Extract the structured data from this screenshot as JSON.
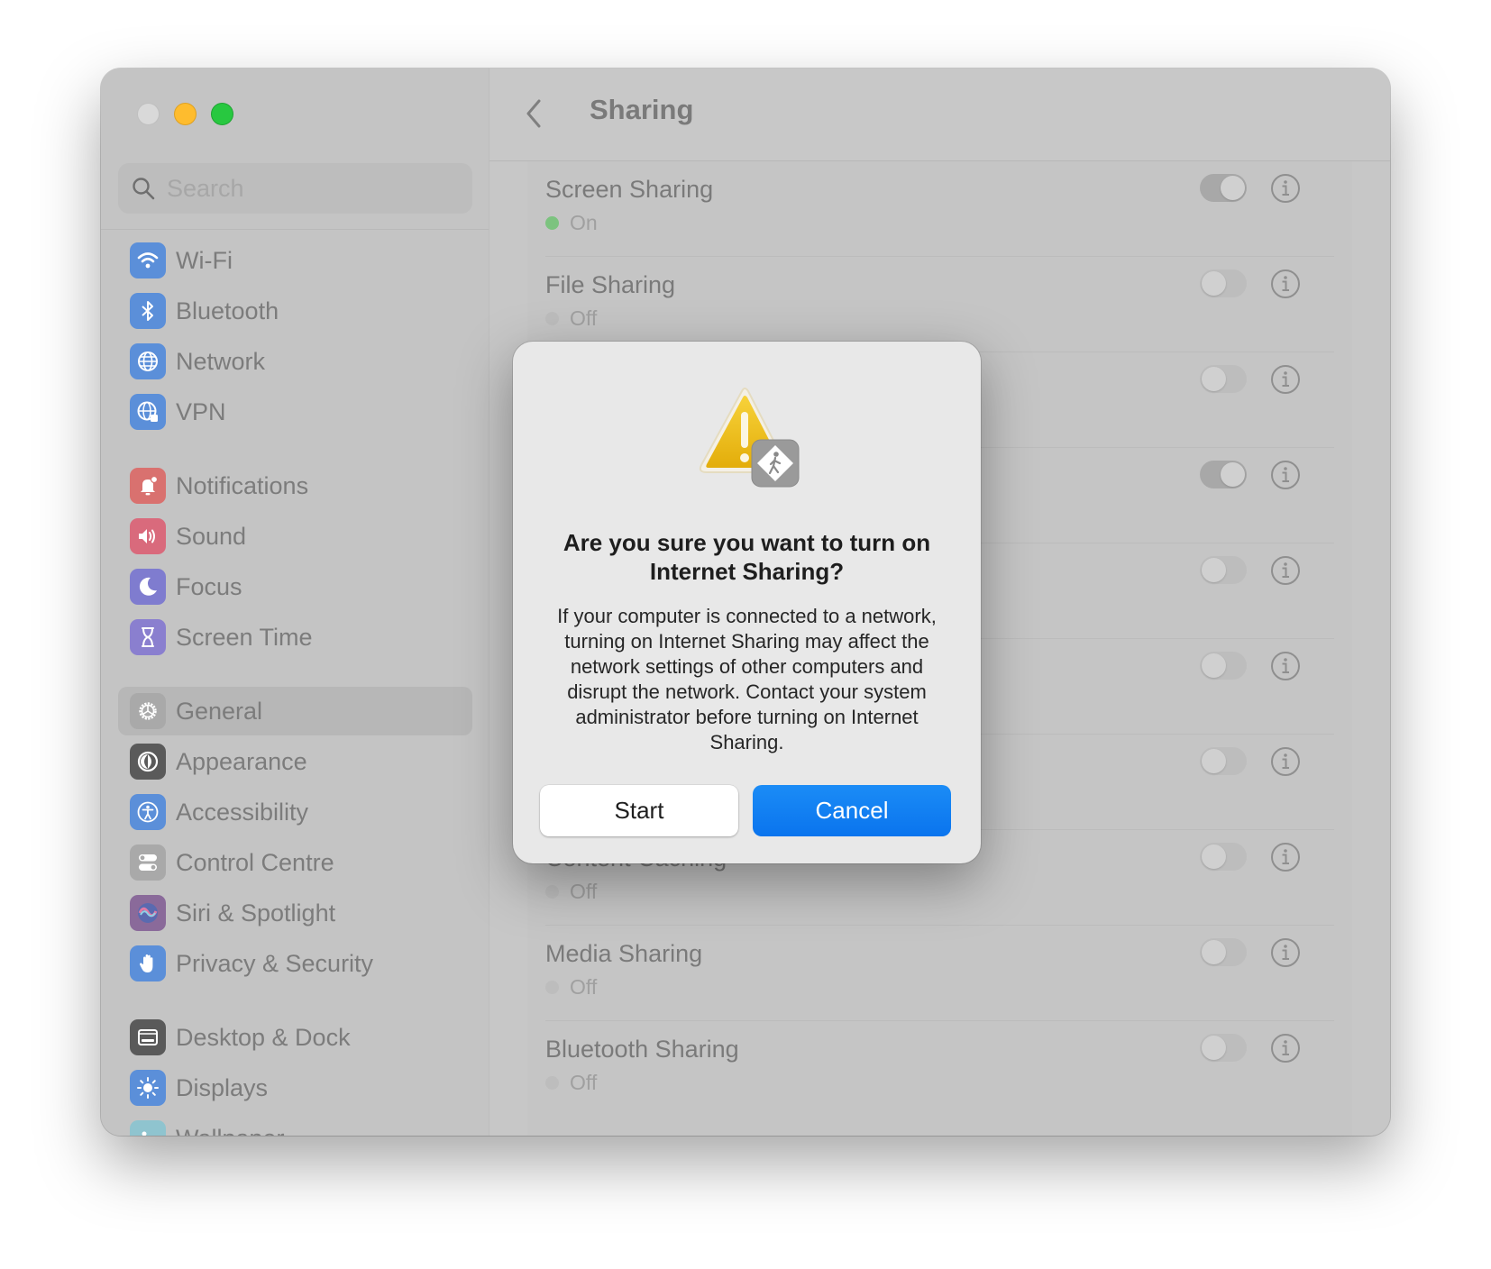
{
  "window": {
    "traffic_lights": [
      "close",
      "minimize",
      "maximize"
    ]
  },
  "sidebar": {
    "search_placeholder": "Search",
    "items": [
      {
        "label": "Wi-Fi",
        "icon": "wifi-icon",
        "color": "#5b8fd9"
      },
      {
        "label": "Bluetooth",
        "icon": "bluetooth-icon",
        "color": "#5b8fd9"
      },
      {
        "label": "Network",
        "icon": "globe-icon",
        "color": "#5b8fd9"
      },
      {
        "label": "VPN",
        "icon": "vpn-globe-icon",
        "color": "#5b8fd9"
      },
      {
        "label": "Notifications",
        "icon": "bell-icon",
        "color": "#d9716f"
      },
      {
        "label": "Sound",
        "icon": "speaker-icon",
        "color": "#d96a7c"
      },
      {
        "label": "Focus",
        "icon": "moon-icon",
        "color": "#7f7ccf"
      },
      {
        "label": "Screen Time",
        "icon": "hourglass-icon",
        "color": "#8a7fcf"
      },
      {
        "label": "General",
        "icon": "gear-icon",
        "color": "#a9a9a9",
        "selected": true
      },
      {
        "label": "Appearance",
        "icon": "appearance-icon",
        "color": "#5a5a5a"
      },
      {
        "label": "Accessibility",
        "icon": "accessibility-icon",
        "color": "#5b8fd9"
      },
      {
        "label": "Control Centre",
        "icon": "control-centre-icon",
        "color": "#a9a9a9"
      },
      {
        "label": "Siri & Spotlight",
        "icon": "siri-icon",
        "color": "#8a6a9a"
      },
      {
        "label": "Privacy & Security",
        "icon": "hand-icon",
        "color": "#5b8fd9"
      },
      {
        "label": "Desktop & Dock",
        "icon": "dock-icon",
        "color": "#5a5a5a"
      },
      {
        "label": "Displays",
        "icon": "sun-icon",
        "color": "#5b8fd9"
      },
      {
        "label": "Wallpaper",
        "icon": "wallpaper-icon",
        "color": "#8fc4cf"
      }
    ]
  },
  "header": {
    "title": "Sharing",
    "back_icon": "chevron-left-icon"
  },
  "sharing_rows": [
    {
      "title": "Screen Sharing",
      "status": "On",
      "enabled": true
    },
    {
      "title": "File Sharing",
      "status": "Off",
      "enabled": false
    },
    {
      "title": "",
      "status": "",
      "enabled": false
    },
    {
      "title": "",
      "status": "",
      "enabled": true
    },
    {
      "title": "",
      "status": "",
      "enabled": false
    },
    {
      "title": "",
      "status": "",
      "enabled": false
    },
    {
      "title": "",
      "status": "",
      "enabled": false
    },
    {
      "title": "Content Caching",
      "status": "Off",
      "enabled": false
    },
    {
      "title": "Media Sharing",
      "status": "Off",
      "enabled": false
    },
    {
      "title": "Bluetooth Sharing",
      "status": "Off",
      "enabled": false
    }
  ],
  "dialog": {
    "icon": "caution-internet-sharing-icon",
    "title": "Are you sure you want to turn on Internet Sharing?",
    "body": "If your computer is connected to a network, turning on Internet Sharing may affect the network settings of other computers and disrupt the network. Contact your system administrator before turning on Internet Sharing.",
    "start_label": "Start",
    "cancel_label": "Cancel"
  },
  "colors": {
    "accent": "#0a74ee",
    "status_on": "#7cc37f",
    "warning_yellow": "#f2c200"
  }
}
